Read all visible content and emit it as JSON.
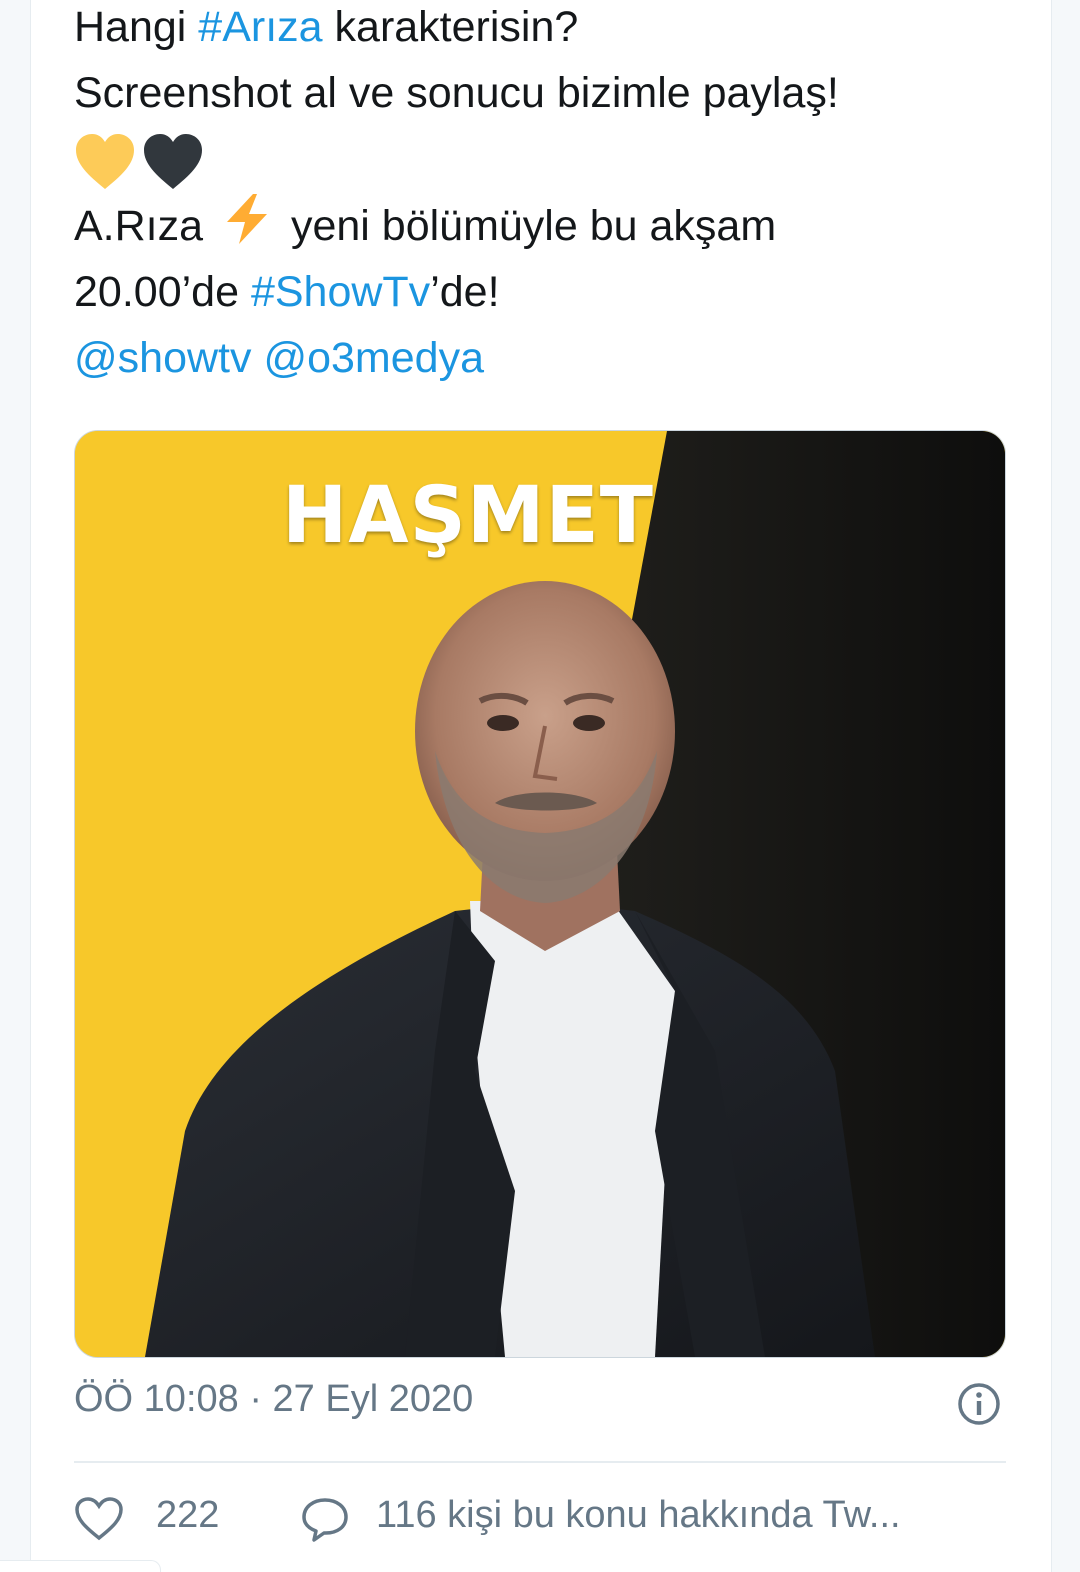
{
  "tweet": {
    "line1_prefix": "Hangi ",
    "line1_hashtag": "#Arıza",
    "line1_suffix": " karakterisin?",
    "line2": "Screenshot al ve sonucu bizimle paylaş!",
    "line3_emojis": [
      "yellow-heart",
      "black-heart"
    ],
    "line4_prefix": "A.Rıza ",
    "line4_emoji": "⚡",
    "line4_suffix": " yeni bölümüyle bu akşam",
    "line5_prefix": "20.00’de ",
    "line5_hashtag": "#ShowTv",
    "line5_suffix": "’de!",
    "mention1": "@showtv",
    "mention2": "@o3medya"
  },
  "media": {
    "title": "HAŞMET",
    "left_color": "#f7c82a",
    "right_color": "#151513"
  },
  "meta": {
    "time": "ÖÖ 10:08",
    "separator": " · ",
    "date": "27 Eyl 2020"
  },
  "actions": {
    "likes": "222",
    "talking": "116 kişi bu konu hakkında Tw..."
  },
  "colors": {
    "link": "#1b95e0",
    "text": "#14171a",
    "secondary": "#657786"
  }
}
